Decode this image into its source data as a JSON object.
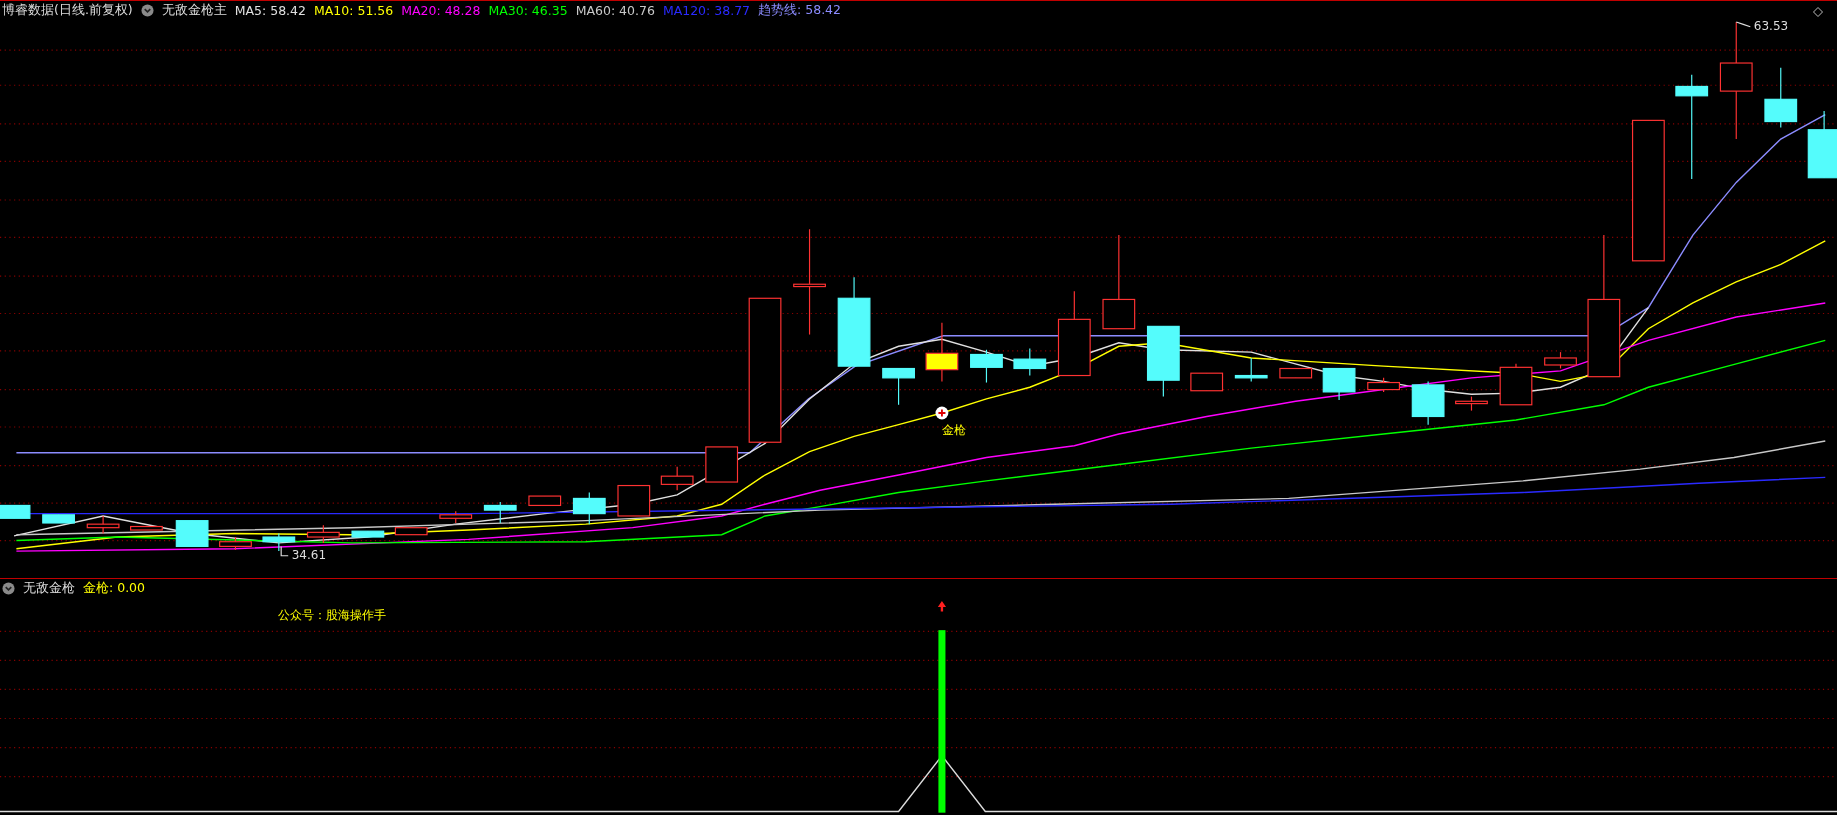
{
  "main_panel": {
    "source_label": "博睿数据(日线.前复权)",
    "indicator_name": "无敌金枪主",
    "ma_values": [
      {
        "label": "MA5: 58.42",
        "color": "#e0e0e0"
      },
      {
        "label": "MA10: 51.56",
        "color": "#ffff00"
      },
      {
        "label": "MA20: 48.28",
        "color": "#ff00ff"
      },
      {
        "label": "MA30: 46.35",
        "color": "#00ff00"
      },
      {
        "label": "MA60: 40.76",
        "color": "#c8c8c8"
      },
      {
        "label": "MA120: 38.77",
        "color": "#2a2aff"
      },
      {
        "label": "趋势线: 58.42",
        "color": "#8c8cff"
      }
    ],
    "high_label": "63.53",
    "low_label": "34.61",
    "signal_label": "金枪"
  },
  "sub_panel": {
    "indicator_name": "无敌金枪",
    "value_label": "金枪: 0.00",
    "note": "公众号：股海操作手"
  }
}
